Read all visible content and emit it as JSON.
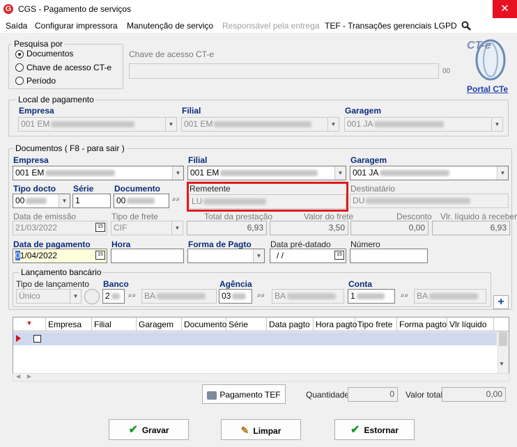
{
  "window": {
    "title": "CGS - Pagamento de serviços",
    "logo_letter": "G",
    "close_glyph": "✕"
  },
  "menu": [
    "Saída",
    "Configurar impressora",
    "Manutenção de serviço",
    "Responsável pela entrega",
    "TEF - Transações gerenciais",
    "LGPD"
  ],
  "pesquisa": {
    "title": "Pesquisa por",
    "options": [
      "Documentos",
      "Chave de acesso CT-e",
      "Período"
    ],
    "selected": "Documentos"
  },
  "chave": {
    "label": "Chave de acesso CT-e",
    "suffix": "00"
  },
  "portal": {
    "link": "Portal CTe",
    "logo_text": "CT-e"
  },
  "local": {
    "title": "Local de pagamento",
    "empresa_label": "Empresa",
    "empresa_value": "001 EM",
    "filial_label": "Filial",
    "filial_value": "001 EM",
    "garagem_label": "Garagem",
    "garagem_value": "001 JA"
  },
  "documentos": {
    "title": "Documentos ( F8 - para sair )",
    "empresa_label": "Empresa",
    "empresa_value": "001 EM",
    "filial_label": "Filial",
    "filial_value": "001 EM",
    "garagem_label": "Garagem",
    "garagem_value": "001 JA",
    "tipo_docto_label": "Tipo docto",
    "tipo_docto_value": "00",
    "serie_label": "Série",
    "serie_value": "1",
    "documento_label": "Documento",
    "documento_value": "00",
    "remetente_label": "Remetente",
    "remetente_value": "LU",
    "destinatario_label": "Destinatário",
    "destinatario_value": "DU",
    "data_emissao_label": "Data de emissão",
    "data_emissao_value": "21/03/2022",
    "tipo_frete_label": "Tipo de frete",
    "tipo_frete_value": "CIF",
    "total_prestacao_label": "Total da prestação",
    "total_prestacao_value": "6,93",
    "valor_frete_label": "Valor do frete",
    "valor_frete_value": "3,50",
    "desconto_label": "Desconto",
    "desconto_value": "0,00",
    "vlr_liquido_label": "Vlr. líquido à receber",
    "vlr_liquido_value": "6,93",
    "data_pagamento_label": "Data de pagamento",
    "data_pagamento_value": "1/04/2022",
    "data_pagamento_caret": "0",
    "hora_label": "Hora",
    "forma_pagto_label": "Forma de Pagto",
    "data_predatado_label": "Data pré-datado",
    "data_predatado_value": "/ /",
    "numero_label": "Número"
  },
  "lancamento": {
    "title": "Lançamento bancário",
    "tipo_label": "Tipo de lançamento",
    "tipo_value": "Único",
    "banco_label": "Banco",
    "banco_code": "2",
    "banco_name": "BA",
    "agencia_label": "Agência",
    "agencia_code": "03",
    "agencia_name": "BA",
    "conta_label": "Conta",
    "conta_code": "1",
    "conta_name": "BA"
  },
  "grid": {
    "columns": [
      "Empresa",
      "Filial",
      "Garagem",
      "Documento",
      "Série",
      "Data pagto",
      "Hora pagto",
      "Tipo frete",
      "Forma pagto",
      "Vlr líquido"
    ]
  },
  "footer": {
    "pagamento_tef": "Pagamento TEF",
    "quantidade_label": "Quantidade",
    "quantidade_value": "0",
    "valor_total_label": "Valor total",
    "valor_total_value": "0,00"
  },
  "buttons": {
    "gravar": "Gravar",
    "limpar": "Limpar",
    "estornar": "Estornar"
  },
  "colors": {
    "close": "#e81123",
    "label_blue": "#0a2b7a",
    "highlight": "#e0191a",
    "grid_row": "#cfd9ee",
    "check_green": "#1a9a2a"
  }
}
